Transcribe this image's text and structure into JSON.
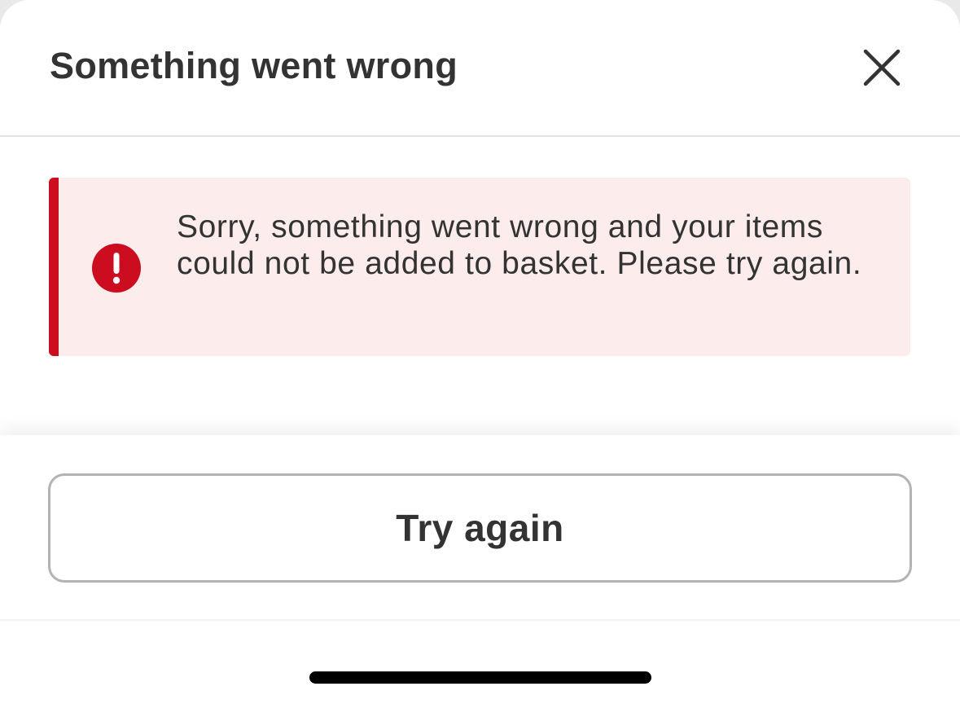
{
  "dialog": {
    "title": "Something went wrong",
    "close_icon": "close-icon"
  },
  "alert": {
    "icon": "error-exclamation-icon",
    "message": "Sorry, something went wrong and your items could not be added to basket. Please try again.",
    "accent_color": "#cc0c1f",
    "background_color": "#fcedec"
  },
  "actions": {
    "try_again_label": "Try again"
  }
}
